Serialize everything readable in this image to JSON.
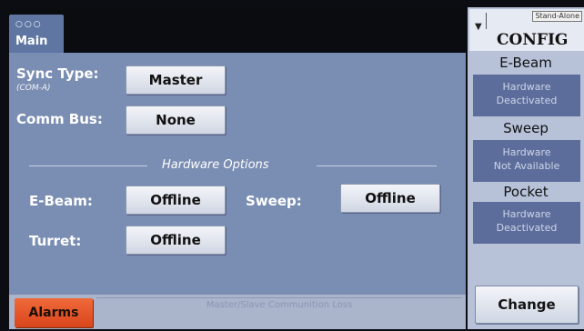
{
  "main_tab": {
    "dots": "○○○",
    "label": "Main"
  },
  "sync": {
    "label": "Sync Type:",
    "sublabel": "(COM-A)",
    "value": "Master"
  },
  "comm": {
    "label": "Comm Bus:",
    "value": "None"
  },
  "hardware_options": {
    "title": "Hardware Options",
    "ebeam_label": "E-Beam:",
    "ebeam_value": "Offline",
    "sweep_label": "Sweep:",
    "sweep_value": "Offline",
    "turret_label": "Turret:",
    "turret_value": "Offline"
  },
  "alarms_label": "Alarms",
  "status_message": "Master/Slave Communition Loss",
  "right": {
    "standalone": "Stand-Alone",
    "config": "CONFIG",
    "sections": [
      {
        "title": "E-Beam",
        "status_line1": "Hardware",
        "status_line2": "Deactivated"
      },
      {
        "title": "Sweep",
        "status_line1": "Hardware",
        "status_line2": "Not Available"
      },
      {
        "title": "Pocket",
        "status_line1": "Hardware",
        "status_line2": "Deactivated"
      }
    ],
    "change_label": "Change"
  },
  "colors": {
    "panel": "#7a8db2",
    "alarm": "#e8552a",
    "status_box": "#5d6d9b",
    "side_panel": "#b7c2d9"
  }
}
